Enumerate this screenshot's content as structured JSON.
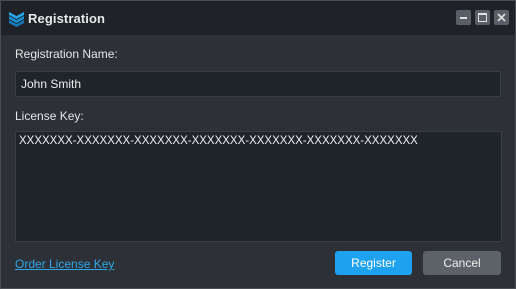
{
  "window": {
    "title": "Registration",
    "controls": [
      "minimize-icon",
      "maximize-icon",
      "close-icon"
    ]
  },
  "form": {
    "name_label": "Registration Name:",
    "name_value": "John Smith",
    "key_label": "License Key:",
    "key_value": "XXXXXXX-XXXXXXX-XXXXXXX-XXXXXXX-XXXXXXX-XXXXXXX-XXXXXXX"
  },
  "footer": {
    "order_link": "Order License Key",
    "register_label": "Register",
    "cancel_label": "Cancel"
  },
  "colors": {
    "accent": "#1ea1ee",
    "link": "#2ea8e8",
    "background": "#2d3037",
    "titlebar": "#1f2226"
  }
}
